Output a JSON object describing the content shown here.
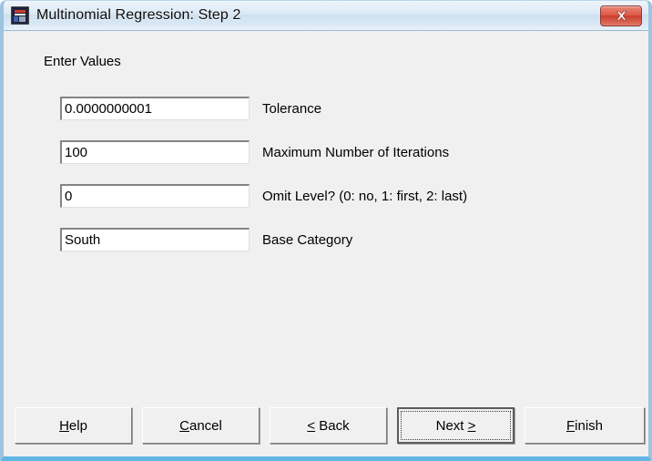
{
  "window": {
    "title": "Multinomial Regression: Step 2",
    "icon": "app-icon",
    "close_label": "Close",
    "frame_color": "#9dc4e0",
    "client_bg": "#f0f0f0",
    "titlebar_color": "#d9e8f5",
    "close_button_color": "#d2503c"
  },
  "content": {
    "section_label": "Enter Values",
    "fields": [
      {
        "name": "tolerance",
        "value": "0.0000000001",
        "placeholder": "",
        "caption": "Tolerance"
      },
      {
        "name": "max-iterations",
        "value": "100",
        "placeholder": "",
        "caption": "Maximum Number of Iterations"
      },
      {
        "name": "omit-level",
        "value": "0",
        "placeholder": "",
        "caption": "Omit Level? (0: no, 1: first, 2: last)"
      },
      {
        "name": "base-category",
        "value": "South",
        "placeholder": "",
        "caption": "Base Category"
      }
    ]
  },
  "buttons": {
    "help": {
      "accel": "H",
      "rest": "elp"
    },
    "cancel": {
      "accel": "C",
      "rest": "ancel"
    },
    "back": {
      "accel": "<",
      "rest": " Back"
    },
    "next": {
      "pre": "Next ",
      "accel": ">"
    },
    "finish": {
      "accel": "F",
      "rest": "inish"
    }
  }
}
